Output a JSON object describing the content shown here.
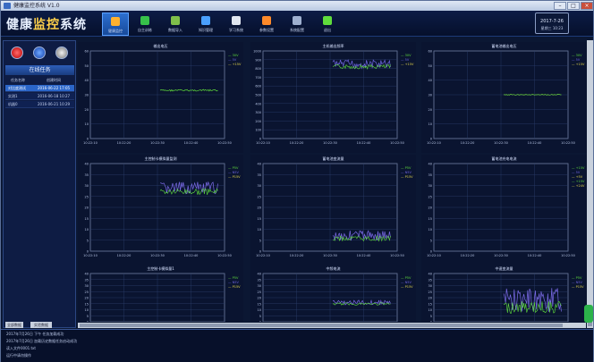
{
  "window": {
    "title": "健康监控系统 V1.0"
  },
  "brand": {
    "prefix": "健康",
    "highlight": "监控",
    "suffix": "系统"
  },
  "toolbar": [
    {
      "label": "健康监控",
      "icon": "bar-chart-icon",
      "active": true
    },
    {
      "label": "自主训练",
      "icon": "checklist-icon",
      "active": false
    },
    {
      "label": "数据导入",
      "icon": "import-icon",
      "active": false
    },
    {
      "label": "知识管理",
      "icon": "book-icon",
      "active": false
    },
    {
      "label": "学习系统",
      "icon": "cloud-icon",
      "active": false
    },
    {
      "label": "参数设置",
      "icon": "settings-icon",
      "active": false
    },
    {
      "label": "系统配置",
      "icon": "gears-icon",
      "active": false
    },
    {
      "label": "退出",
      "icon": "exit-icon",
      "active": false
    }
  ],
  "clock": {
    "date": "2017-7-26",
    "time": "星期三 10:23"
  },
  "sidebar": {
    "title": "在线任务",
    "columns": [
      "任务名称",
      "创建时间"
    ],
    "tasks": [
      {
        "name": "对比度测试",
        "time": "2016-06-22 17:05",
        "selected": true
      },
      {
        "name": "实测1",
        "time": "2016-06-18 10:27",
        "selected": false
      },
      {
        "name": "机器0",
        "time": "2016-06-21 10:29",
        "selected": false
      }
    ],
    "footer_left": "全部数据",
    "footer_right": "实验数据"
  },
  "charts": [
    {
      "title": "输出电压",
      "ymin": 0,
      "ymax": 60,
      "ticks": [
        "60",
        "50",
        "40",
        "30",
        "20",
        "10",
        "0"
      ],
      "xticks": [
        "10:22:10",
        "10:22:20",
        "10:22:30",
        "10:22:40",
        "10:22:50"
      ],
      "legend": [
        "30V",
        "5V",
        "+15V"
      ],
      "level": 0.55,
      "noise": 0.01,
      "series": "#5fdc3c"
    },
    {
      "title": "主机输出频率",
      "ymin": 0,
      "ymax": 1000,
      "ticks": [
        "1000",
        "900",
        "800",
        "700",
        "600",
        "500",
        "400",
        "300",
        "200",
        "100",
        "0"
      ],
      "xticks": [
        "10:22:10",
        "10:22:20",
        "10:22:30",
        "10:22:40",
        "10:22:50"
      ],
      "legend": [
        "30V",
        "5V",
        "+15V"
      ],
      "level": 0.85,
      "noise": 0.05,
      "series": "#6f65e0"
    },
    {
      "title": "蓄电池输出电压",
      "ymin": 0,
      "ymax": 60,
      "ticks": [
        "60",
        "50",
        "40",
        "30",
        "20",
        "10",
        "0"
      ],
      "xticks": [
        "10:22:10",
        "10:22:20",
        "10:22:30",
        "10:22:40",
        "10:22:50"
      ],
      "legend": [
        "30V",
        "5V",
        "+15V"
      ],
      "level": 0.5,
      "noise": 0.005,
      "series": "#6fdc3c"
    },
    {
      "title": "主控制卡模拟量监测",
      "ymin": 0,
      "ymax": 40,
      "ticks": [
        "40",
        "35",
        "30",
        "25",
        "20",
        "15",
        "10",
        "5",
        "0"
      ],
      "xticks": [
        "10:22:10",
        "10:22:20",
        "10:22:30",
        "10:22:40",
        "10:22:50"
      ],
      "legend": [
        "P5V",
        "N5V",
        "P15V"
      ],
      "level": 0.72,
      "noise": 0.07,
      "series": "#7a6ae6"
    },
    {
      "title": "蓄电池变流量",
      "ymin": 0,
      "ymax": 40,
      "ticks": [
        "40",
        "35",
        "30",
        "25",
        "20",
        "15",
        "10",
        "5",
        "0"
      ],
      "xticks": [
        "10:22:10",
        "10:22:20",
        "10:22:30",
        "10:22:40",
        "10:22:50"
      ],
      "legend": [
        "P5V",
        "N5V",
        "P15V"
      ],
      "level": 0.18,
      "noise": 0.06,
      "series": "#7a6ae6"
    },
    {
      "title": "蓄电池充电电流",
      "ymin": 0,
      "ymax": 40,
      "ticks": [
        "40",
        "35",
        "30",
        "25",
        "20",
        "15",
        "10",
        "5",
        "0"
      ],
      "xticks": [
        "10:22:10",
        "10:22:20",
        "10:22:30",
        "10:22:40",
        "10:22:50"
      ],
      "legend": [
        "+15V",
        "5V",
        "+5V",
        "+15V",
        "+24V"
      ],
      "level": 0,
      "noise": 0,
      "series": "#6fdc3c"
    },
    {
      "title": "主控制卡模拟量1",
      "ymin": 0,
      "ymax": 40,
      "ticks": [
        "40",
        "35",
        "30",
        "25",
        "20",
        "15",
        "10",
        "5",
        "0"
      ],
      "xticks": [
        "10:22:10",
        "10:22:20",
        "10:22:30",
        "10:22:40",
        "10:22:50"
      ],
      "legend": [
        "P5V",
        "N5V",
        "P15V"
      ],
      "level": 0,
      "noise": 0,
      "series": "#6fdc3c"
    },
    {
      "title": "中频电流",
      "ymin": 0,
      "ymax": 40,
      "ticks": [
        "40",
        "35",
        "30",
        "25",
        "20",
        "15",
        "10",
        "5",
        "0"
      ],
      "xticks": [
        "10:22:10",
        "10:22:20",
        "10:22:30",
        "10:22:40",
        "10:22:50"
      ],
      "legend": [
        "P5V",
        "N5V",
        "P15V"
      ],
      "level": 0.4,
      "noise": 0.05,
      "series": "#7a6ae6"
    },
    {
      "title": "中速变流量",
      "ymin": 0,
      "ymax": 40,
      "ticks": [
        "40",
        "35",
        "30",
        "25",
        "20",
        "15",
        "10",
        "5",
        "0"
      ],
      "xticks": [
        "10:22:10",
        "10:22:20",
        "10:22:30",
        "10:22:40",
        "10:22:50"
      ],
      "legend": [
        "P5V",
        "N5V",
        "P15V"
      ],
      "level": 0.45,
      "noise": 0.25,
      "series": "#7a6ae6"
    }
  ],
  "log": [
    "2017年7月26日 下午 任务加载成功",
    "2017年7月26日 加载历史数据任务启动成功",
    "读入文件0001.txt",
    "运行中请勿操作"
  ]
}
